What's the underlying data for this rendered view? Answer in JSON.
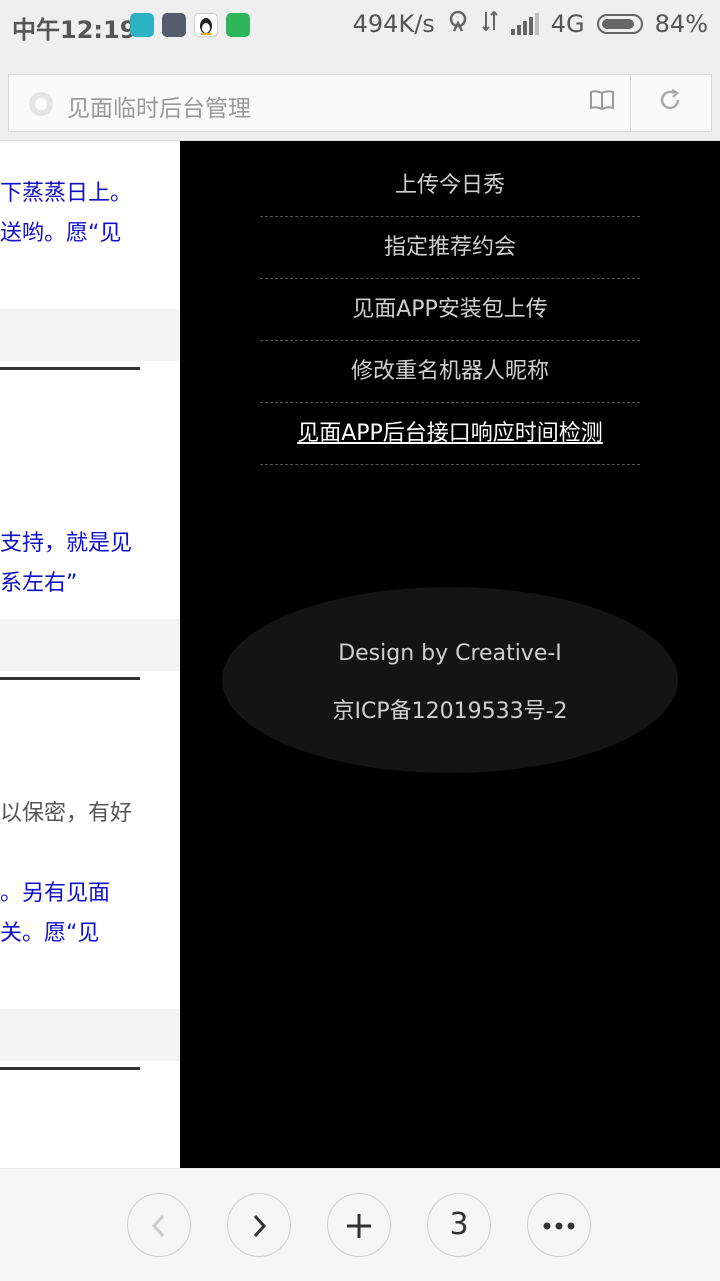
{
  "status_bar": {
    "time": "中午12:19",
    "net_speed": "494K/s",
    "network": "4G",
    "battery": "84%",
    "battery_level": 0.84,
    "app_icons": [
      {
        "name": "app-icon-1",
        "color": "#2bb3c4"
      },
      {
        "name": "app-icon-2",
        "color": "#555c6b"
      },
      {
        "name": "qq-penguin-icon",
        "color": "#222222"
      },
      {
        "name": "app-icon-4",
        "color": "#2fb55a"
      }
    ]
  },
  "address_bar": {
    "title": "见面临时后台管理",
    "reader_icon": "book-icon",
    "reload_icon": "reload-icon"
  },
  "left_pane": {
    "lines": [
      "下蒸蒸日上。",
      "送哟。愿“见",
      "支持，就是见",
      "系左右”",
      "以保密，有好",
      "。另有见面",
      "关。愿“见"
    ]
  },
  "menu": {
    "items": [
      {
        "label": "上传今日秀"
      },
      {
        "label": "指定推荐约会"
      },
      {
        "label": "见面APP安装包上传"
      },
      {
        "label": "修改重名机器人昵称"
      },
      {
        "label": "见面APP后台接口响应时间检测"
      }
    ]
  },
  "footer": {
    "design": "Design by Creative-I",
    "icp": "京ICP备12019533号-2"
  },
  "bottom_nav": {
    "back_icon": "chevron-left-icon",
    "forward_icon": "chevron-right-icon",
    "new_tab_icon": "plus-icon",
    "tab_count": "3",
    "more_icon": "more-dots-icon"
  }
}
